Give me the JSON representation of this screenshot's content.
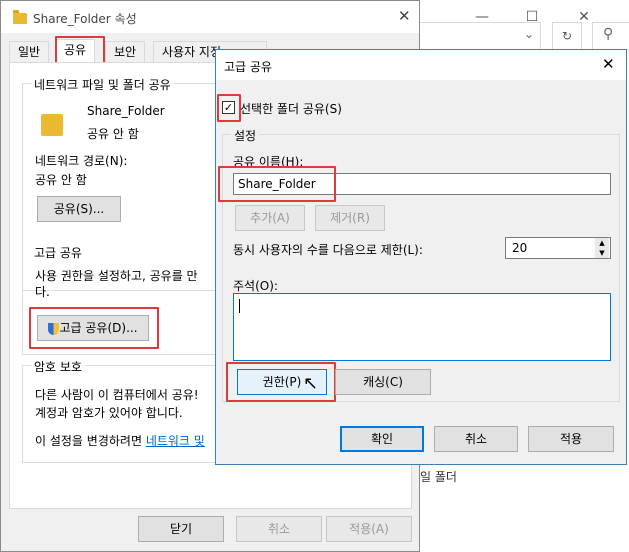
{
  "explorer": {
    "fragment_text": "일 폴더"
  },
  "properties": {
    "title": "Share_Folder 속성",
    "tabs": [
      "일반",
      "공유",
      "보안",
      "사용자 지정"
    ],
    "network_group": {
      "title": "네트워크 파일 및 폴더 공유",
      "folder_name": "Share_Folder",
      "folder_status": "공유 안 함",
      "path_label": "네트워크 경로(N):",
      "path_value": "공유 안 함",
      "share_button": "공유(S)..."
    },
    "advanced_group": {
      "title": "고급 공유",
      "description_line1": "사용 권한을 설정하고, 공유를 만",
      "description_line2": "다.",
      "button": "고급 공유(D)..."
    },
    "password_group": {
      "title": "암호 보호",
      "line1": "다른 사람이 이 컴퓨터에서 공유!",
      "line2": "계정과 암호가 있어야 합니다.",
      "line3_prefix": "이 설정을 변경하려면 ",
      "line3_link": "네트워크 및"
    },
    "footer": {
      "close": "닫기",
      "cancel": "취소",
      "apply": "적용(A)"
    }
  },
  "advanced_sharing": {
    "title": "고급 공유",
    "share_checkbox_label": "선택한 폴더 공유(S)",
    "share_checked": true,
    "settings_title": "설정",
    "share_name_label": "공유 이름(H):",
    "share_name_value": "Share_Folder",
    "add_button": "추가(A)",
    "remove_button": "제거(R)",
    "limit_label": "동시 사용자의 수를 다음으로 제한(L):",
    "limit_value": "20",
    "comment_label": "주석(O):",
    "comment_value": "",
    "permissions_button": "권한(P)",
    "caching_button": "캐싱(C)",
    "ok_button": "확인",
    "cancel_button": "취소",
    "apply_button": "적용"
  },
  "colors": {
    "highlight_red": "#e0393e",
    "accent_blue": "#0078d7",
    "folder_yellow": "#e8b931"
  }
}
